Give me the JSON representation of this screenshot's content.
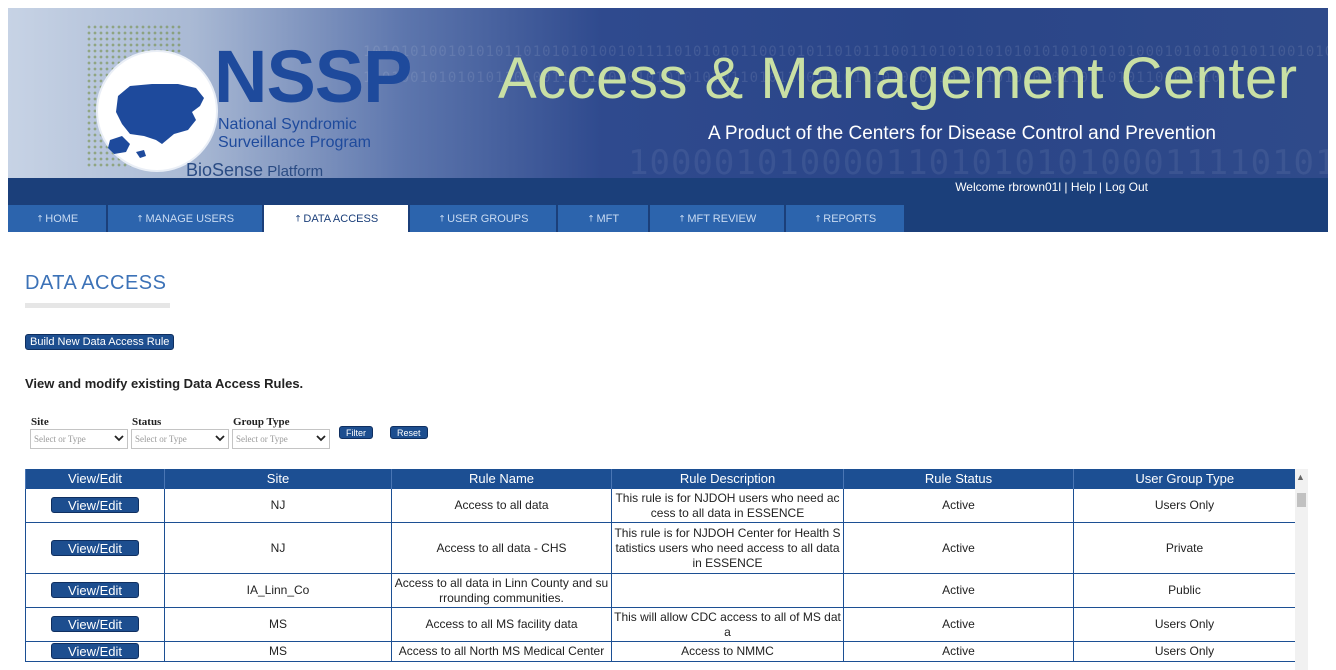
{
  "banner": {
    "logo_name": "NSSP",
    "logo_line1": "National Syndromic",
    "logo_line2": "Surveillance Program",
    "platform_bold": "BioSense",
    "platform_rest": " Platform",
    "title": "Access & Management Center",
    "subtitle": "A Product of the Centers for Disease Control and Prevention",
    "binary_1": "1010101001010101101010101001011110101010110010101101011100110101010101010101010101000101010101011001010",
    "binary_2": "1101001010101011010011011001010101010101101011001010101010101101011010101011011010110101010",
    "binary_3": "1000010100001101010101000111101010"
  },
  "header": {
    "welcome": "Welcome rbrown01l",
    "separator": " | ",
    "help": "Help",
    "logout": "Log Out"
  },
  "nav": {
    "tabs": [
      {
        "label": "HOME"
      },
      {
        "label": "MANAGE USERS"
      },
      {
        "label": "DATA ACCESS"
      },
      {
        "label": "USER GROUPS"
      },
      {
        "label": "MFT"
      },
      {
        "label": "MFT REVIEW"
      },
      {
        "label": "REPORTS"
      }
    ],
    "active": "DATA ACCESS"
  },
  "page": {
    "title": "DATA ACCESS",
    "build_button": "Build New Data Access Rule",
    "subheading": "View and modify existing Data Access Rules."
  },
  "filters": {
    "site_label": "Site",
    "status_label": "Status",
    "group_type_label": "Group Type",
    "placeholder": "Select or Type",
    "filter_button": "Filter",
    "reset_button": "Reset"
  },
  "table": {
    "columns": [
      "View/Edit",
      "Site",
      "Rule Name",
      "Rule Description",
      "Rule Status",
      "User Group Type"
    ],
    "view_edit_label": "View/Edit",
    "rows": [
      {
        "site": "NJ",
        "rule_name": "Access to all data",
        "description": "This rule is for NJDOH users who need access to all data in ESSENCE",
        "status": "Active",
        "group_type": "Users Only"
      },
      {
        "site": "NJ",
        "rule_name": "Access to all data - CHS",
        "description": "This rule is for NJDOH Center for Health Statistics users who need access to all data in ESSENCE",
        "status": "Active",
        "group_type": "Private"
      },
      {
        "site": "IA_Linn_Co",
        "rule_name": "Access to all data in Linn County and surrounding communities.",
        "description": "",
        "status": "Active",
        "group_type": "Public"
      },
      {
        "site": "MS",
        "rule_name": "Access to all MS facility data",
        "description": "This will allow CDC access to all of MS data",
        "status": "Active",
        "group_type": "Users Only"
      },
      {
        "site": "MS",
        "rule_name": "Access to all North MS Medical Center",
        "description": "Access to NMMC",
        "status": "Active",
        "group_type": "Users Only"
      }
    ]
  }
}
